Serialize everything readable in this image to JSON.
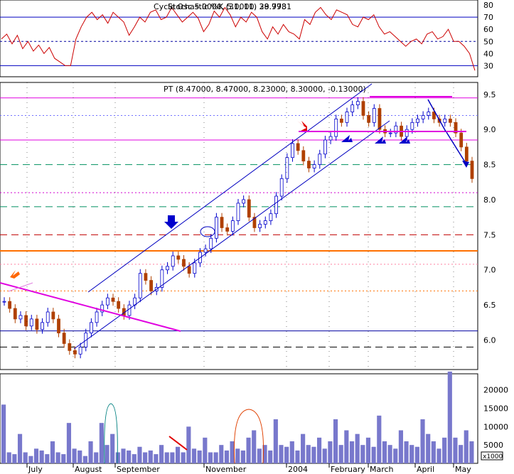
{
  "chart_data": [
    {
      "panel": "cycle-indicator",
      "type": "line",
      "title": "Cycle Osc 5.0000, 5.0000, 38.9981",
      "overlay_title": "Stochastic %K (31, 11) 29.773",
      "ylim": [
        22,
        83
      ],
      "yticks": [
        30,
        40,
        50,
        60,
        70,
        80
      ],
      "reference_lines": [
        70,
        50,
        30
      ],
      "color": "#cc0000",
      "values": [
        52,
        56,
        48,
        55,
        44,
        50,
        42,
        47,
        40,
        45,
        36,
        33,
        30,
        30,
        52,
        62,
        70,
        74,
        68,
        72,
        65,
        74,
        70,
        66,
        55,
        62,
        70,
        66,
        74,
        76,
        68,
        70,
        78,
        72,
        66,
        70,
        74,
        69,
        58,
        64,
        75,
        70,
        78,
        72,
        62,
        70,
        66,
        74,
        70,
        58,
        52,
        62,
        56,
        64,
        58,
        56,
        52,
        68,
        64,
        74,
        78,
        72,
        68,
        76,
        74,
        72,
        64,
        62,
        70,
        68,
        72,
        62,
        56,
        58,
        54,
        50,
        46,
        50,
        52,
        48,
        56,
        58,
        52,
        54,
        60,
        50,
        50,
        46,
        40,
        26
      ]
    },
    {
      "panel": "price",
      "type": "candlestick",
      "title": "PT (8.47000, 8.47000, 8.23000, 8.30000, -0.13000)",
      "ylim": [
        5.6,
        9.65
      ],
      "yticks": [
        6.0,
        6.5,
        7.0,
        7.5,
        8.0,
        8.5,
        9.0,
        9.5
      ],
      "close": [
        6.55,
        6.45,
        6.3,
        6.35,
        6.2,
        6.3,
        6.15,
        6.25,
        6.4,
        6.3,
        6.1,
        5.95,
        5.85,
        5.8,
        5.9,
        6.1,
        6.25,
        6.4,
        6.5,
        6.6,
        6.55,
        6.45,
        6.35,
        6.5,
        6.6,
        6.95,
        6.85,
        6.7,
        6.75,
        7.0,
        7.05,
        7.2,
        7.15,
        7.05,
        6.95,
        7.1,
        7.25,
        7.3,
        7.45,
        7.75,
        7.6,
        7.55,
        7.7,
        7.95,
        8.0,
        7.75,
        7.6,
        7.65,
        7.7,
        7.8,
        8.05,
        8.3,
        8.6,
        8.8,
        8.7,
        8.55,
        8.45,
        8.5,
        8.65,
        8.85,
        8.9,
        9.15,
        9.1,
        9.25,
        9.35,
        9.4,
        9.2,
        9.1,
        9.3,
        9.0,
        8.95,
        8.95,
        9.05,
        8.9,
        9.0,
        9.1,
        9.15,
        9.2,
        9.25,
        9.15,
        9.1,
        9.15,
        9.1,
        8.95,
        8.75,
        8.55,
        8.3
      ],
      "reference_lines": [
        {
          "value": 9.45,
          "color": "#e000e0",
          "style": "solid"
        },
        {
          "value": 9.2,
          "color": "#7070ff",
          "style": "dotted"
        },
        {
          "value": 8.85,
          "color": "#e000e0",
          "style": "solid"
        },
        {
          "value": 8.5,
          "color": "#009060",
          "style": "dashed"
        },
        {
          "value": 8.1,
          "color": "#d000d0",
          "style": "dotted"
        },
        {
          "value": 7.9,
          "color": "#009060",
          "style": "dashed"
        },
        {
          "value": 7.5,
          "color": "#c00000",
          "style": "dashed"
        },
        {
          "value": 7.27,
          "color": "#ff7000",
          "style": "solid"
        },
        {
          "value": 7.08,
          "color": "#ff80a0",
          "style": "dotted"
        },
        {
          "value": 6.7,
          "color": "#ff7000",
          "style": "dotted"
        },
        {
          "value": 6.13,
          "color": "#0000a0",
          "style": "solid"
        },
        {
          "value": 5.9,
          "color": "#000000",
          "style": "dashed"
        }
      ]
    },
    {
      "panel": "volume",
      "type": "bar",
      "ylim": [
        0,
        24000
      ],
      "yticks": [
        5000,
        10000,
        15000,
        20000
      ],
      "unit_label": "x1000",
      "color": "#7878cc",
      "values": [
        16000,
        3000,
        2500,
        8000,
        3000,
        2000,
        4000,
        3500,
        2500,
        6000,
        3000,
        2500,
        11000,
        4000,
        3500,
        2000,
        6000,
        3000,
        11000,
        5000,
        8000,
        3000,
        4000,
        3500,
        2500,
        4500,
        3000,
        3500,
        2500,
        5000,
        3000,
        3000,
        4500,
        3000,
        10000,
        4000,
        3500,
        7000,
        3000,
        3000,
        5000,
        3500,
        6000,
        4000,
        3500,
        7000,
        9000,
        4000,
        5000,
        3500,
        12000,
        5000,
        4500,
        6000,
        3500,
        8000,
        5000,
        4500,
        7000,
        4000,
        6000,
        12000,
        5000,
        9000,
        6000,
        8000,
        5000,
        7000,
        4500,
        13000,
        6000,
        5000,
        4000,
        9000,
        6000,
        5000,
        4500,
        12000,
        8000,
        6000,
        4000,
        7000,
        25000,
        7000,
        5000,
        9000,
        6000
      ]
    }
  ],
  "x_axis_labels": [
    "July",
    "August",
    "September",
    "November",
    "2004",
    "February",
    "March",
    "April",
    "May"
  ]
}
